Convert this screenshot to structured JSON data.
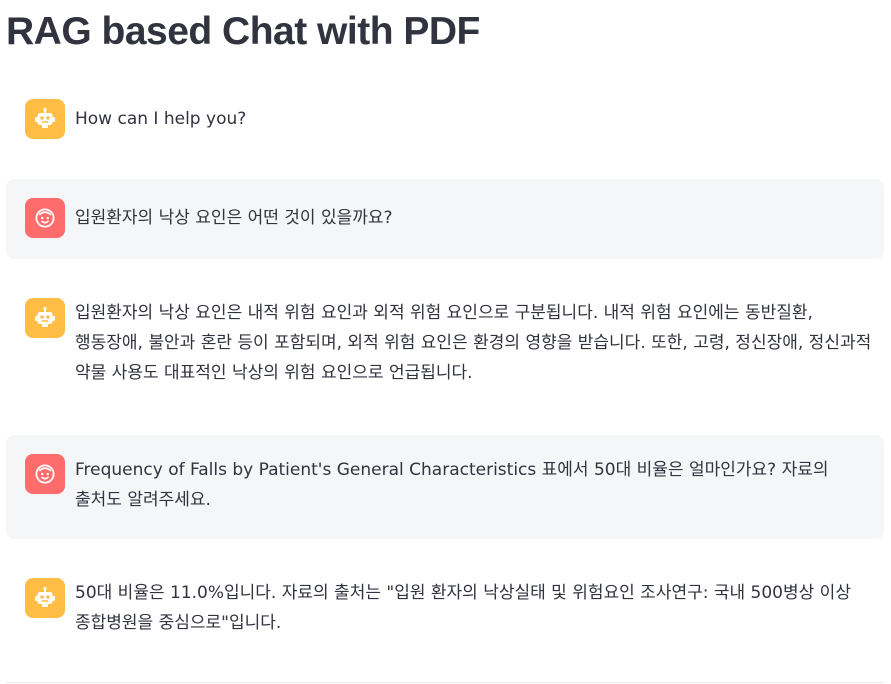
{
  "page": {
    "title": "RAG based Chat with PDF"
  },
  "messages": [
    {
      "role": "assistant",
      "avatar_icon": "robot-icon",
      "text": "How can I help you?"
    },
    {
      "role": "user",
      "avatar_icon": "smiley-face-icon",
      "text": "입원환자의 낙상 요인은 어떤 것이 있을까요?"
    },
    {
      "role": "assistant",
      "avatar_icon": "robot-icon",
      "text": "입원환자의 낙상 요인은 내적 위험 요인과 외적 위험 요인으로 구분됩니다. 내적 위험 요인에는 동반질환, 행동장애, 불안과 혼란 등이 포함되며, 외적 위험 요인은 환경의 영향을 받습니다. 또한, 고령, 정신장애, 정신과적 약물 사용도 대표적인 낙상의 위험 요인으로 언급됩니다."
    },
    {
      "role": "user",
      "avatar_icon": "smiley-face-icon",
      "text": "Frequency of Falls by Patient's General Characteristics 표에서 50대 비율은 얼마인가요? 자료의 출처도 알려주세요."
    },
    {
      "role": "assistant",
      "avatar_icon": "robot-icon",
      "text": "50대 비율은 11.0%입니다. 자료의 출처는 \"입원 환자의 낙상실태 및 위험요인 조사연구: 국내 500병상 이상 종합병원을 중심으로\"입니다."
    }
  ],
  "colors": {
    "assistant_avatar": "#ffbd45",
    "user_avatar": "#ff6c6c",
    "user_message_background": "#f5f6f8",
    "text": "#31333f"
  }
}
